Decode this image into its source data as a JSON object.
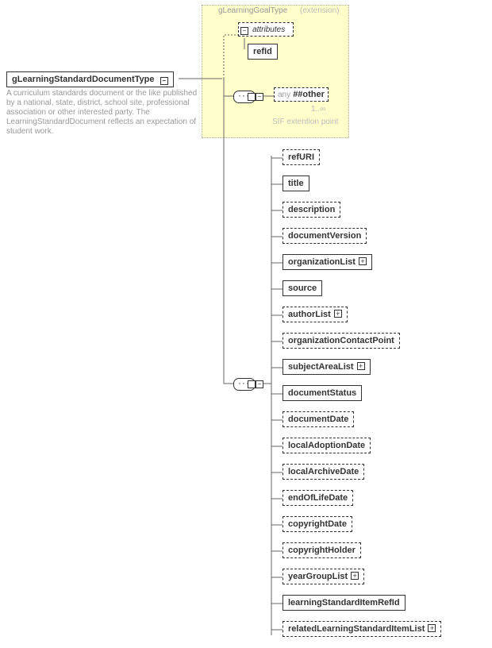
{
  "root": {
    "name": "gLearningStandardDocumentType",
    "desc": "A curriculum standards document or the like published by a national, state, district, school site, professional association or other interested party. The LearningStandardDocument reflects an expectation of student work."
  },
  "extension": {
    "title": "gLearningGoalType",
    "suffix": "(extension)",
    "attr_header": "attributes",
    "attr": "refId",
    "any_prefix": "any",
    "any_ns": "##other",
    "occurs": "1..∞",
    "note": "SIF extention point"
  },
  "elements": [
    {
      "label": "refURI",
      "opt": true,
      "exp": false
    },
    {
      "label": "title",
      "opt": false,
      "exp": false
    },
    {
      "label": "description",
      "opt": true,
      "exp": false
    },
    {
      "label": "documentVersion",
      "opt": true,
      "exp": false
    },
    {
      "label": "organizationList",
      "opt": false,
      "exp": true
    },
    {
      "label": "source",
      "opt": false,
      "exp": false
    },
    {
      "label": "authorList",
      "opt": true,
      "exp": true
    },
    {
      "label": "organizationContactPoint",
      "opt": true,
      "exp": false
    },
    {
      "label": "subjectAreaList",
      "opt": false,
      "exp": true
    },
    {
      "label": "documentStatus",
      "opt": false,
      "exp": false
    },
    {
      "label": "documentDate",
      "opt": true,
      "exp": false
    },
    {
      "label": "localAdoptionDate",
      "opt": true,
      "exp": false
    },
    {
      "label": "localArchiveDate",
      "opt": true,
      "exp": false
    },
    {
      "label": "endOfLifeDate",
      "opt": true,
      "exp": false
    },
    {
      "label": "copyrightDate",
      "opt": true,
      "exp": false
    },
    {
      "label": "copyrightHolder",
      "opt": true,
      "exp": false
    },
    {
      "label": "yearGroupList",
      "opt": true,
      "exp": true
    },
    {
      "label": "learningStandardItemRefId",
      "opt": false,
      "exp": false
    },
    {
      "label": "relatedLearningStandardItemList",
      "opt": true,
      "exp": true
    }
  ]
}
